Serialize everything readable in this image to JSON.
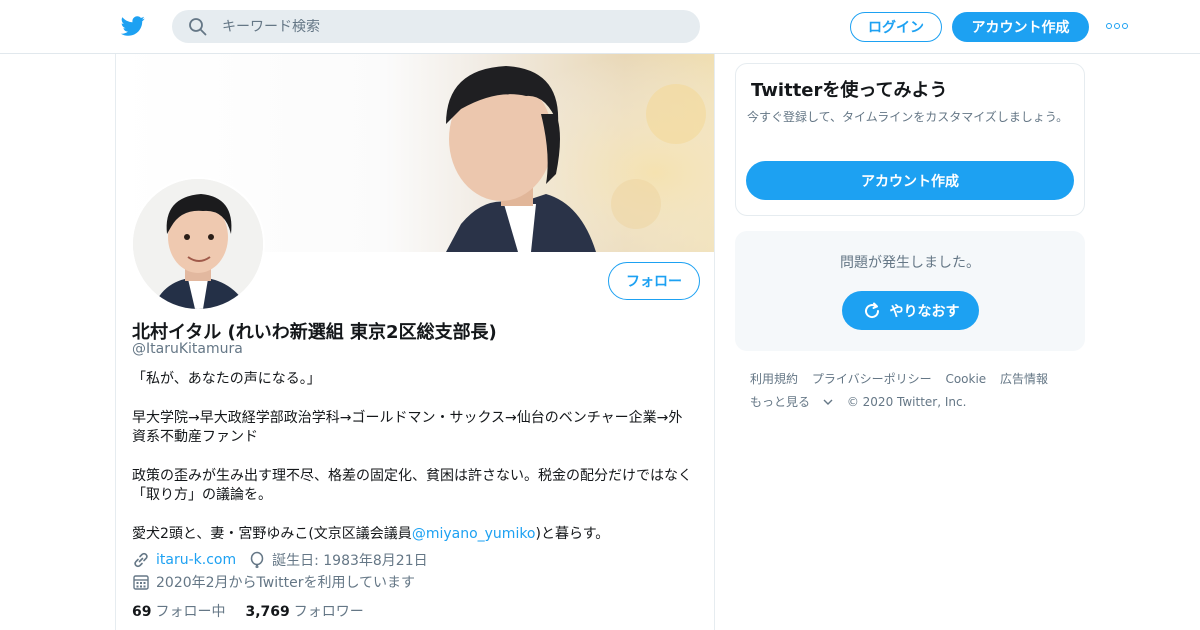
{
  "header": {
    "search_placeholder": "キーワード検索",
    "login_label": "ログイン",
    "signup_label": "アカウント作成"
  },
  "profile": {
    "name": "北村イタル (れいわ新選組 東京2区総支部長)",
    "handle": "@ItaruKitamura",
    "follow_label": "フォロー",
    "bio": {
      "line1": "「私が、あなたの声になる。」",
      "line2": "早大学院→早大政経学部政治学科→ゴールドマン・サックス→仙台のベンチャー企業→外資系不動産ファンド",
      "line3": "政策の歪みが生み出す理不尽、格差の固定化、貧困は許さない。税金の配分だけではなく「取り方」の議論を。",
      "line4_pre": "愛犬2頭と、妻・宮野ゆみこ(文京区議会議員",
      "line4_link": "@miyano_yumiko",
      "line4_post": ")と暮らす。"
    },
    "website": "itaru-k.com",
    "birthday": "誕生日: 1983年8月21日",
    "joined": "2020年2月からTwitterを利用しています",
    "following_count": "69",
    "following_label": "フォロー中",
    "followers_count": "3,769",
    "followers_label": "フォロワー"
  },
  "sidebar": {
    "promo_title": "Twitterを使ってみよう",
    "promo_desc": "今すぐ登録して、タイムラインをカスタマイズしましょう。",
    "promo_cta": "アカウント作成",
    "error_msg": "問題が発生しました。",
    "retry_label": "やりなおす",
    "footer": {
      "terms": "利用規約",
      "privacy": "プライバシーポリシー",
      "cookie": "Cookie",
      "ads": "広告情報",
      "more": "もっと見る",
      "copyright": "© 2020 Twitter, Inc."
    }
  },
  "colors": {
    "accent": "#1da1f2",
    "muted": "#657786",
    "text": "#14171a"
  },
  "icons": [
    "twitter-bird-icon",
    "search-icon",
    "more-dots-icon",
    "link-icon",
    "balloon-icon",
    "calendar-icon",
    "refresh-icon",
    "chevron-down-icon"
  ]
}
